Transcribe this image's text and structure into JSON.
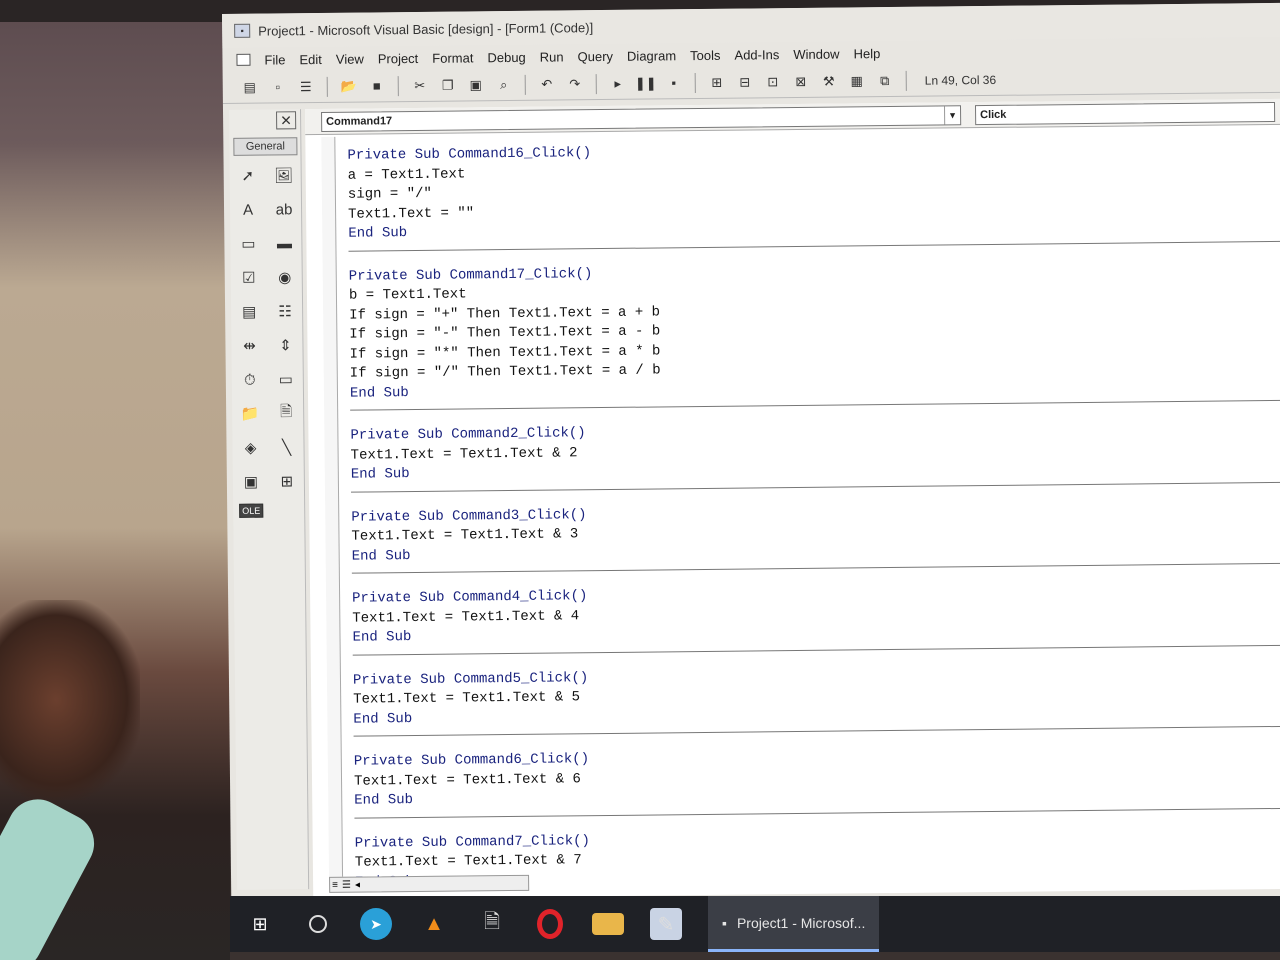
{
  "window": {
    "title": "Project1 - Microsoft Visual Basic [design] - [Form1 (Code)]"
  },
  "menu": [
    "File",
    "Edit",
    "View",
    "Project",
    "Format",
    "Debug",
    "Run",
    "Query",
    "Diagram",
    "Tools",
    "Add-Ins",
    "Window",
    "Help"
  ],
  "toolbar": {
    "cursor_position": "Ln 49, Col 36"
  },
  "toolbox": {
    "tab_label": "General",
    "tools": [
      "pointer-tool",
      "picturebox-tool",
      "label-tool",
      "textbox-tool",
      "frame-tool",
      "commandbutton-tool",
      "checkbox-tool",
      "optionbutton-tool",
      "combobox-tool",
      "listbox-tool",
      "hscrollbar-tool",
      "vscrollbar-tool",
      "timer-tool",
      "drivelistbox-tool",
      "dirlistbox-tool",
      "filelistbox-tool",
      "shape-tool",
      "line-tool",
      "image-tool",
      "data-tool",
      "ole-tool"
    ],
    "ole_label": "OLE"
  },
  "code_window": {
    "object_combo": "Command17",
    "procedure_combo": "Click"
  },
  "code": {
    "procedures": [
      {
        "lines": [
          "Private Sub Command16_Click()",
          "a = Text1.Text",
          "sign = \"/\"",
          "Text1.Text = \"\"",
          "End Sub"
        ]
      },
      {
        "lines": [
          "Private Sub Command17_Click()",
          "b = Text1.Text",
          "If sign = \"+\" Then Text1.Text = a + b",
          "If sign = \"-\" Then Text1.Text = a - b",
          "If sign = \"*\" Then Text1.Text = a * b",
          "If sign = \"/\" Then Text1.Text = a / b",
          "End Sub"
        ]
      },
      {
        "lines": [
          "Private Sub Command2_Click()",
          "Text1.Text = Text1.Text & 2",
          "End Sub"
        ]
      },
      {
        "lines": [
          "Private Sub Command3_Click()",
          "Text1.Text = Text1.Text & 3",
          "End Sub"
        ]
      },
      {
        "lines": [
          "Private Sub Command4_Click()",
          "Text1.Text = Text1.Text & 4",
          "End Sub"
        ]
      },
      {
        "lines": [
          "Private Sub Command5_Click()",
          "Text1.Text = Text1.Text & 5",
          "End Sub"
        ]
      },
      {
        "lines": [
          "Private Sub Command6_Click()",
          "Text1.Text = Text1.Text & 6",
          "End Sub"
        ]
      },
      {
        "lines": [
          "Private Sub Command7_Click()",
          "Text1.Text = Text1.Text & 7",
          "End Sub"
        ]
      }
    ]
  },
  "taskbar": {
    "active_window_label": "Project1 - Microsof..."
  }
}
